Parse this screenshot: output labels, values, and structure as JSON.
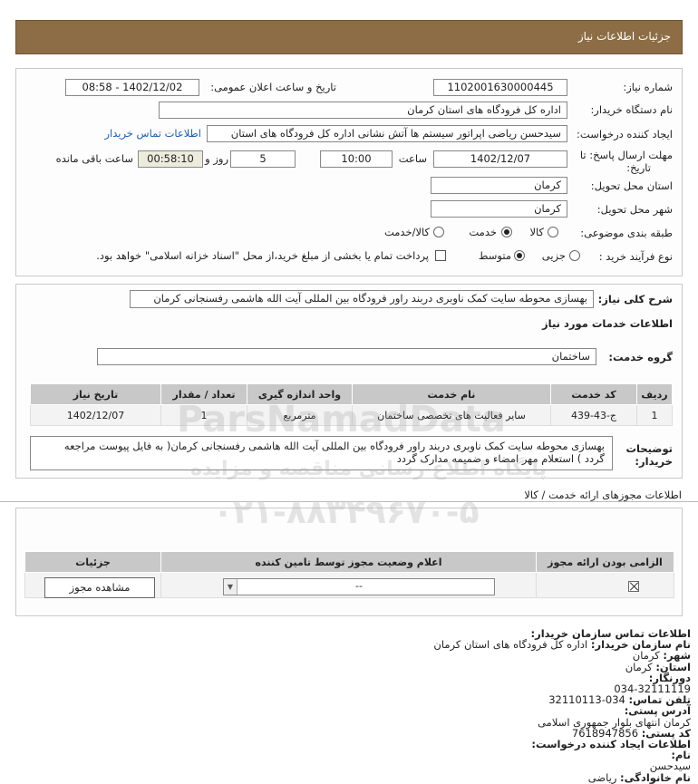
{
  "header": {
    "title": "جزئیات اطلاعات نیاز"
  },
  "form": {
    "need_number_label": "شماره نیاز:",
    "need_number": "1102001630000445",
    "announce_label": "تاریخ و ساعت اعلان عمومی:",
    "announce_value": "1402/12/02 - 08:58",
    "buyer_label": "نام دستگاه خریدار:",
    "buyer_value": "اداره کل فرودگاه های استان کرمان",
    "creator_label": "ایجاد کننده درخواست:",
    "creator_value": "سیدحسن ریاضی اپراتور سیستم ها آتش نشانی اداره کل فرودگاه های استان",
    "contact_link": "اطلاعات تماس خریدار",
    "deadline_label_1": "مهلت ارسال پاسخ: تا",
    "deadline_label_2": "تاریخ:",
    "deadline_date": "1402/12/07",
    "time_label": "ساعت",
    "deadline_time": "10:00",
    "days_value": "5",
    "days_label": "روز و",
    "remaining_time": "00:58:10",
    "remaining_label": "ساعت باقی مانده",
    "province_label": "استان محل تحویل:",
    "province_value": "کرمان",
    "city_label": "شهر محل تحویل:",
    "city_value": "کرمان",
    "category_label": "طبقه بندی موضوعی:",
    "category_options": [
      "کالا",
      "خدمت",
      "کالا/خدمت"
    ],
    "category_selected": "خدمت",
    "process_label": "نوع فرآیند خرید :",
    "process_options": [
      "جزیی",
      "متوسط"
    ],
    "process_selected": "متوسط",
    "payment_note": "پرداخت تمام یا بخشی از مبلغ خرید،از محل \"اسناد خزانه اسلامی\" خواهد بود."
  },
  "summary": {
    "label": "شرح کلی نیاز:",
    "value": "بهسازی محوطه سایت کمک ناوبری دربند راور فرودگاه بین المللی آیت الله هاشمی رفسنجانی کرمان",
    "services_title": "اطلاعات خدمات مورد نیاز",
    "group_label": "گروه خدمت:",
    "group_value": "ساختمان"
  },
  "table": {
    "headers": [
      "ردیف",
      "کد خدمت",
      "نام خدمت",
      "واحد اندازه گیری",
      "تعداد / مقدار",
      "تاریخ نیاز"
    ],
    "rows": [
      [
        "1",
        "ج-43-439",
        "سایر فعالیت های تخصصی ساختمان",
        "مترمربع",
        "1",
        "1402/12/07"
      ]
    ]
  },
  "buyer_notes": {
    "label_1": "توضیحات",
    "label_2": "خریدار:",
    "line1": "بهسازی محوطه سایت کمک ناوبری دربند راور فرودگاه بین المللی آیت الله هاشمی رفسنجانی کرمان( به فایل پیوست مراجعه",
    "line2": "گردد ) استعلام مهر امضاء و ضمیمه مدارک گردد"
  },
  "permits": {
    "title": "اطلاعات مجوزهای ارائه خدمت / کالا",
    "headers": [
      "الزامی بودن ارائه مجوز",
      "اعلام وضعیت مجوز توسط تامین کننده",
      "جزئیات"
    ],
    "select_value": "--",
    "view_button": "مشاهده مجوز"
  },
  "contact": {
    "title": "اطلاعات تماس سازمان خریدار:",
    "org_label": "نام سازمان خریدار:",
    "org_value": "اداره کل فرودگاه های استان کرمان",
    "city_label": "شهر:",
    "city_value": "کرمان",
    "province_label": "استان:",
    "province_value": "کرمان",
    "fax_label": "دورنگار:",
    "fax_value": "034-32111119",
    "phone_label": "تلفن تماس:",
    "phone_value": "034-32110113",
    "address_label": "آدرس پستی:",
    "address_value": "کرمان انتهای بلوار جمهوری اسلامی",
    "postal_label": "کد پستی:",
    "postal_value": "7618947856",
    "creator_title": "اطلاعات ایجاد کننده درخواست:",
    "name_label": "نام:",
    "name_value": "سیدحسن",
    "family_label": "نام خانوادگی:",
    "family_value": "ریاضی"
  },
  "watermark": {
    "brand": "ParsNamadData",
    "tagline": "پایگاه اطلاع رسانی مناقصه و مزایده",
    "phone": "۰۲۱-۸۸۳۴۹۶۷۰-۵"
  }
}
